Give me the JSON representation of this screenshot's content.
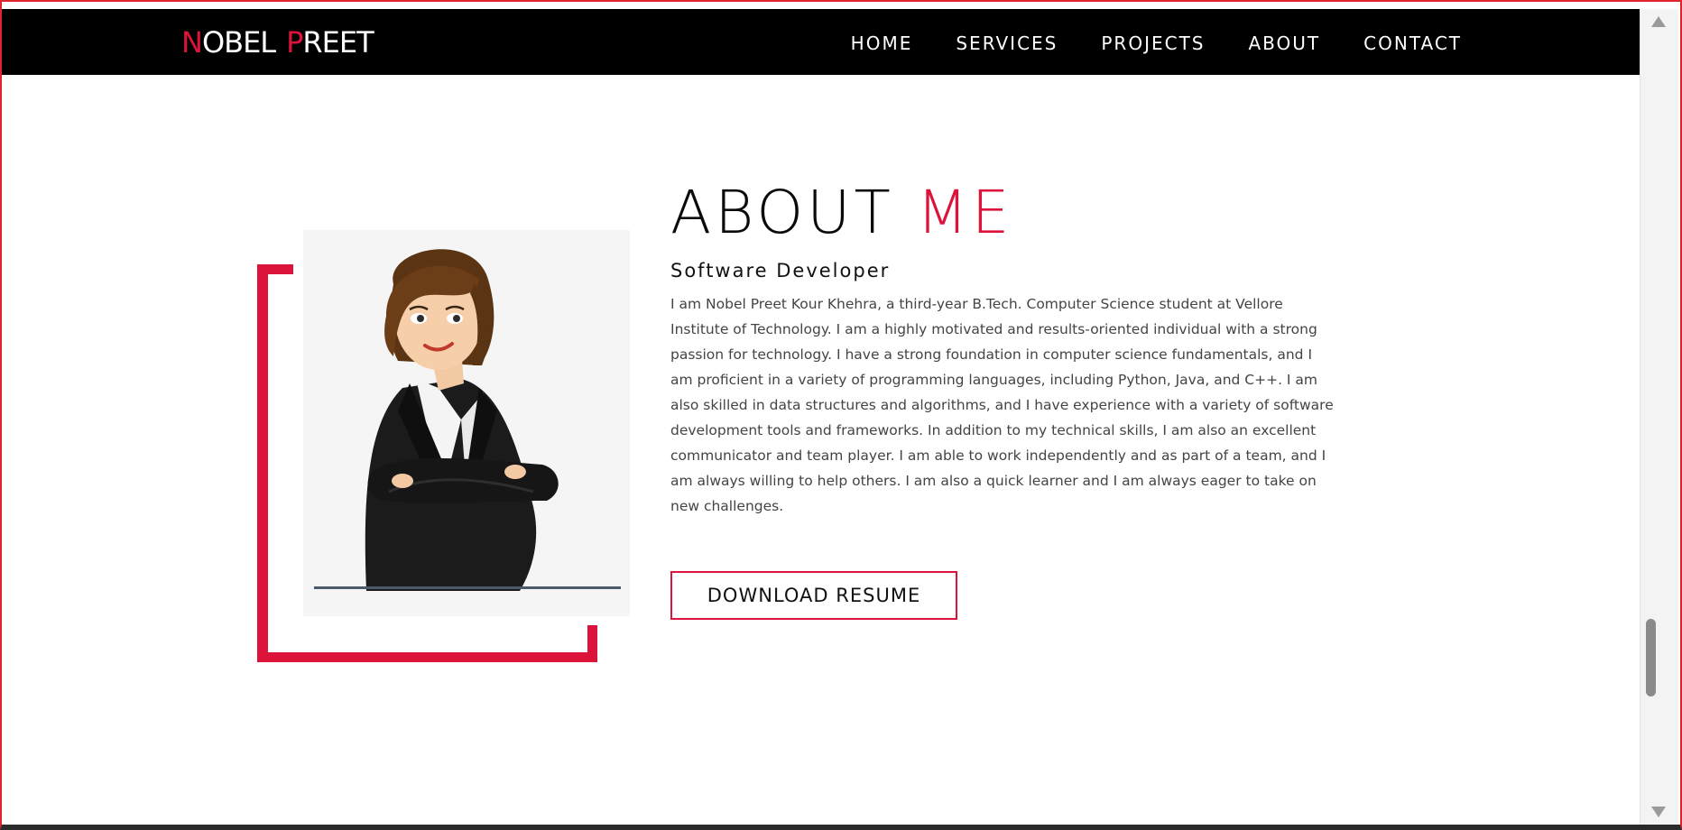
{
  "brand": {
    "first_initial": "N",
    "first_rest": "OBEL",
    "last_initial": "P",
    "last_rest": "REET"
  },
  "nav": {
    "items": [
      "HOME",
      "SERVICES",
      "PROJECTS",
      "ABOUT",
      "CONTACT"
    ]
  },
  "about": {
    "title_main": "ABOUT",
    "title_accent": "ME",
    "subtitle": "Software Developer",
    "bio_lines": [
      "I am Nobel Preet Kour Khehra, a third-year B.Tech. Computer Science student at Vellore",
      "Institute of Technology. I am a highly motivated and results-oriented individual with a strong",
      "passion for technology. I have a strong foundation in computer science fundamentals, and I",
      "am proficient in a variety of programming languages, including Python, Java, and C++. I am",
      "also skilled in data structures and algorithms, and I have experience with a variety of software",
      "development tools and frameworks. In addition to my technical skills, I am also an excellent",
      "communicator and team player. I am able to work independently and as part of a team, and I",
      "am always willing to help others. I am also a quick learner and I am always eager to take on",
      "new challenges."
    ],
    "button_label": "DOWNLOAD RESUME"
  },
  "colors": {
    "accent": "#dc143c",
    "navbar_bg": "#000000",
    "text_dark": "#111111",
    "text_body": "#444444"
  },
  "icons": {
    "profile_image": "businesswoman-illustration"
  }
}
